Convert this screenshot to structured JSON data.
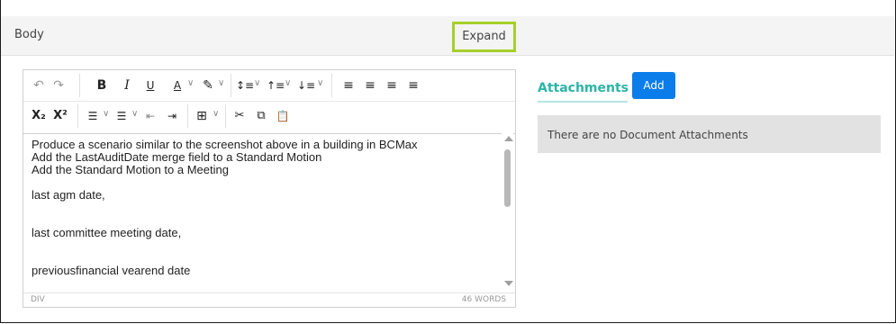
{
  "header": {
    "title": "Body",
    "expand_label": "Expand"
  },
  "toolbar": {
    "row1": {
      "undo": "↶",
      "redo": "↷",
      "bold": "B",
      "italic": "I",
      "underline": "U",
      "font_color": "A",
      "highlight": "✎",
      "line_height": "↕≡",
      "space_before": "↑≡",
      "space_after": "↓≡",
      "align_left": "≡",
      "align_center": "≡",
      "align_right": "≡",
      "justify": "≡"
    },
    "row2": {
      "subscript": "X₂",
      "superscript": "X²",
      "bullet_list": "☰",
      "numbered_list": "☰",
      "outdent": "⇤",
      "indent": "⇥",
      "table": "⊞",
      "cut": "✂",
      "copy": "⧉",
      "paste": "📋"
    }
  },
  "editor": {
    "lines": [
      "Produce a scenario similar to the screenshot above in a building in BCMax",
      "Add the LastAuditDate merge field to a Standard Motion",
      "Add the Standard Motion to a Meeting",
      "last agm date,",
      "last committee meeting date,",
      "previousfinancial vearend date"
    ],
    "status_path": "DIV",
    "word_count": "46 WORDS"
  },
  "attachments": {
    "title": "Attachments",
    "add_label": "Add",
    "empty_message": "There are no Document Attachments",
    "colors": {
      "title": "#2bb5a7",
      "button": "#0b7dea"
    }
  }
}
